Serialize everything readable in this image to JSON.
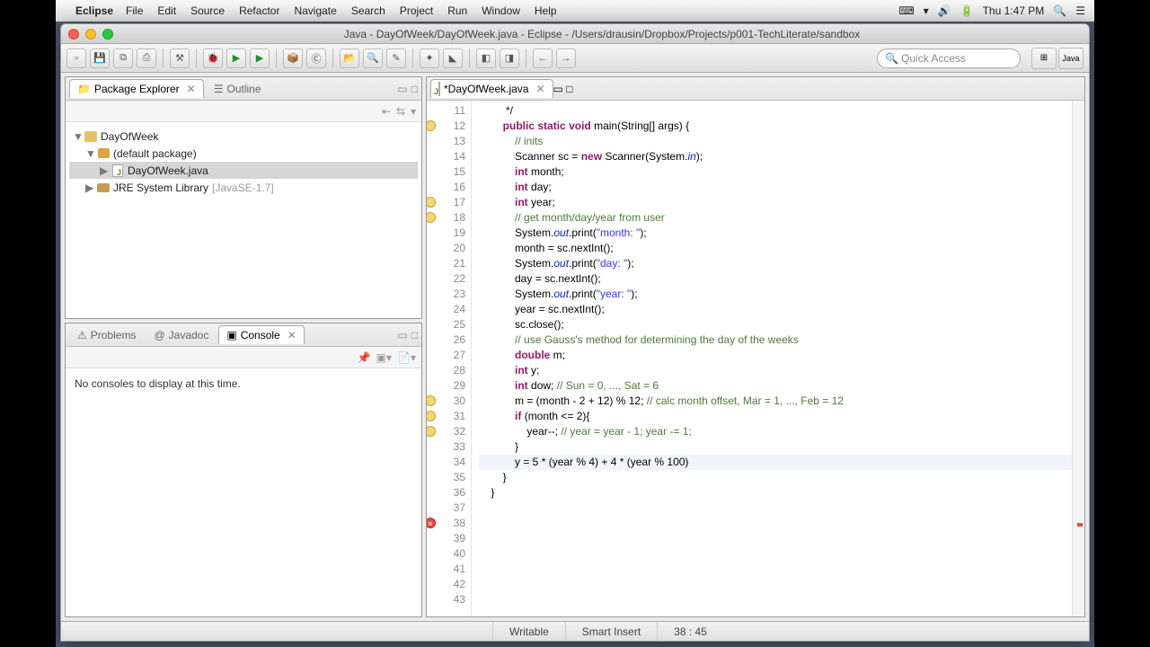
{
  "mac_menu": {
    "app": "Eclipse",
    "items": [
      "File",
      "Edit",
      "Source",
      "Refactor",
      "Navigate",
      "Search",
      "Project",
      "Run",
      "Window",
      "Help"
    ],
    "clock": "Thu 1:47 PM"
  },
  "window": {
    "title": "Java - DayOfWeek/DayOfWeek.java - Eclipse - /Users/drausin/Dropbox/Projects/p001-TechLiterate/sandbox"
  },
  "quick_access": {
    "placeholder": "Quick Access"
  },
  "perspective": {
    "active": "Java"
  },
  "views": {
    "package_explorer": {
      "title": "Package Explorer"
    },
    "outline": {
      "title": "Outline"
    },
    "problems": {
      "title": "Problems"
    },
    "javadoc": {
      "title": "Javadoc"
    },
    "console": {
      "title": "Console",
      "empty_msg": "No consoles to display at this time."
    }
  },
  "tree": {
    "project": "DayOfWeek",
    "package": "(default package)",
    "file": "DayOfWeek.java",
    "lib": "JRE System Library",
    "lib_suffix": "[JavaSE-1.7]"
  },
  "editor": {
    "tab": "*DayOfWeek.java",
    "first_line_no": 11,
    "lines": [
      {
        "n": 11,
        "t": "         */"
      },
      {
        "n": 12,
        "mark": "warn",
        "t": "        <kw>public</kw> <kw>static</kw> <kw>void</kw> main(String[] args) {"
      },
      {
        "n": 13,
        "t": ""
      },
      {
        "n": 14,
        "t": "            <cm>// inits</cm>"
      },
      {
        "n": 15,
        "t": "            Scanner sc = <kw>new</kw> Scanner(System.<fld>in</fld>);"
      },
      {
        "n": 16,
        "t": "            <kw>int</kw> month;"
      },
      {
        "n": 17,
        "mark": "warn",
        "t": "            <kw>int</kw> day;"
      },
      {
        "n": 18,
        "mark": "warn",
        "t": "            <kw>int</kw> year;"
      },
      {
        "n": 19,
        "t": ""
      },
      {
        "n": 20,
        "t": "            <cm>// get month/day/year from user</cm>"
      },
      {
        "n": 21,
        "t": "            System.<fld>out</fld>.print(<str>\"month: \"</str>);"
      },
      {
        "n": 22,
        "t": "            month = sc.nextInt();"
      },
      {
        "n": 23,
        "t": "            System.<fld>out</fld>.print(<str>\"day: \"</str>);"
      },
      {
        "n": 24,
        "t": "            day = sc.nextInt();"
      },
      {
        "n": 25,
        "t": "            System.<fld>out</fld>.print(<str>\"year: \"</str>);"
      },
      {
        "n": 26,
        "t": "            year = sc.nextInt();"
      },
      {
        "n": 27,
        "t": "            sc.close();"
      },
      {
        "n": 28,
        "t": ""
      },
      {
        "n": 29,
        "t": "            <cm>// use Gauss's method for determining the day of the weeks</cm>"
      },
      {
        "n": 30,
        "mark": "warn",
        "t": "            <kw>double</kw> m;"
      },
      {
        "n": 31,
        "mark": "warn",
        "t": "            <kw>int</kw> y;"
      },
      {
        "n": 32,
        "mark": "warn",
        "t": "            <kw>int</kw> dow; <cm>// Sun = 0, ..., Sat = 6</cm>"
      },
      {
        "n": 33,
        "t": ""
      },
      {
        "n": 34,
        "t": "            m = (month - 2 + 12) % 12; <cm>// calc month offset, Mar = 1, ..., Feb = 12</cm>"
      },
      {
        "n": 35,
        "t": "            <kw>if</kw> (month <= 2){"
      },
      {
        "n": 36,
        "t": "                year--; <cm>// year = year - 1; year -= 1;</cm>"
      },
      {
        "n": 37,
        "t": "            }"
      },
      {
        "n": 38,
        "mark": "err",
        "cur": true,
        "t": "            y = 5 * (year % 4) + 4 * (year % 100)"
      },
      {
        "n": 39,
        "t": ""
      },
      {
        "n": 40,
        "t": ""
      },
      {
        "n": 41,
        "t": "        }"
      },
      {
        "n": 42,
        "t": ""
      },
      {
        "n": 43,
        "t": "    }"
      }
    ]
  },
  "status": {
    "writable": "Writable",
    "insert": "Smart Insert",
    "pos": "38 : 45"
  }
}
